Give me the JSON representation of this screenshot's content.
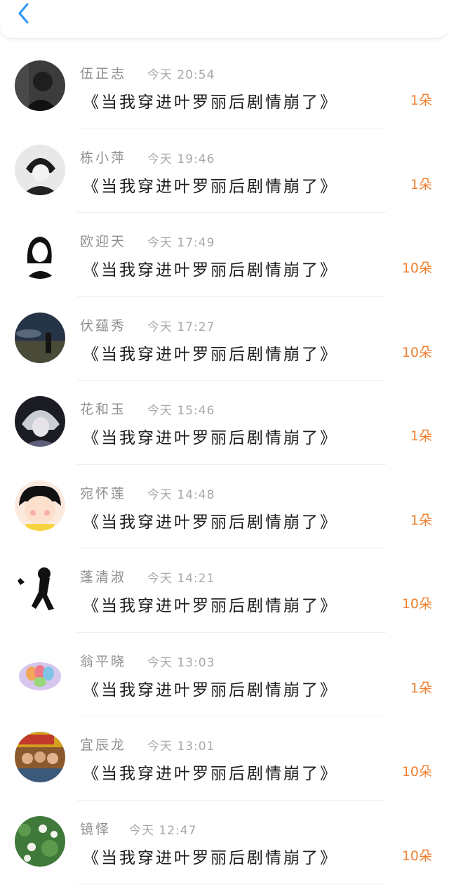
{
  "header": {
    "back_icon": "chevron-left-icon",
    "accent_color": "#2f95f5"
  },
  "records": [
    {
      "name": "伍正志",
      "time": "今天 20:54",
      "title": "《当我穿进叶罗丽后剧情崩了》",
      "amount": "1朵",
      "avatar": "dark-portrait-avatar"
    },
    {
      "name": "栋小萍",
      "time": "今天 19:46",
      "title": "《当我穿进叶罗丽后剧情崩了》",
      "amount": "1朵",
      "avatar": "anime-boy-avatar"
    },
    {
      "name": "欧迎天",
      "time": "今天 17:49",
      "title": "《当我穿进叶罗丽后剧情崩了》",
      "amount": "10朵",
      "avatar": "sketch-girl-avatar"
    },
    {
      "name": "伏蕴秀",
      "time": "今天 17:27",
      "title": "《当我穿进叶罗丽后剧情崩了》",
      "amount": "10朵",
      "avatar": "night-sky-avatar"
    },
    {
      "name": "花和玉",
      "time": "今天 15:46",
      "title": "《当我穿进叶罗丽后剧情崩了》",
      "amount": "1朵",
      "avatar": "anime-silver-hair-avatar"
    },
    {
      "name": "宛怀莲",
      "time": "今天 14:48",
      "title": "《当我穿进叶罗丽后剧情崩了》",
      "amount": "1朵",
      "avatar": "cartoon-girl-avatar"
    },
    {
      "name": "蓬清淑",
      "time": "今天 14:21",
      "title": "《当我穿进叶罗丽后剧情崩了》",
      "amount": "10朵",
      "avatar": "silhouette-girl-avatar"
    },
    {
      "name": "翁平晓",
      "time": "今天 13:03",
      "title": "《当我穿进叶罗丽后剧情崩了》",
      "amount": "1朵",
      "avatar": "macaron-bowl-avatar"
    },
    {
      "name": "宜辰龙",
      "time": "今天 13:01",
      "title": "《当我穿进叶罗丽后剧情崩了》",
      "amount": "10朵",
      "avatar": "movie-poster-avatar"
    },
    {
      "name": "镜怿",
      "time": "今天 12:47",
      "title": "《当我穿进叶罗丽后剧情崩了》",
      "amount": "10朵",
      "avatar": "green-flowers-avatar"
    }
  ]
}
